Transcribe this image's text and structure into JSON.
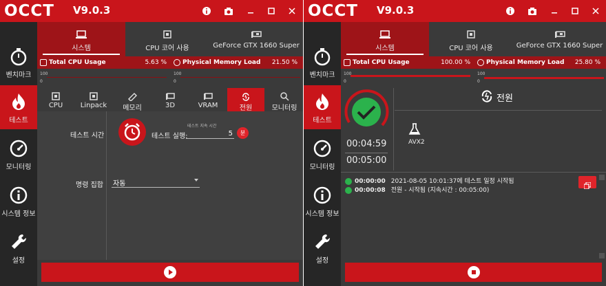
{
  "app": {
    "logo_text": "OCCT",
    "version": "V9.0.3",
    "title_icons": [
      "info-icon",
      "camera-icon",
      "minimize-icon",
      "maximize-icon",
      "close-icon"
    ]
  },
  "colors": {
    "accent": "#c9151b",
    "accent_dark": "#9e1418",
    "sidebar_bg": "#262626",
    "content_bg": "#3a3a3a",
    "success": "#2bb24c"
  },
  "sidebar": {
    "items": [
      {
        "label": "벤치마크",
        "icon": "stopwatch-icon"
      },
      {
        "label": "테스트",
        "icon": "flame-icon"
      },
      {
        "label": "모니터링",
        "icon": "gauge-icon"
      },
      {
        "label": "시스템 정보",
        "icon": "info-circle-icon"
      },
      {
        "label": "설정",
        "icon": "wrench-icon"
      }
    ]
  },
  "device_tabs": [
    {
      "label": "시스템",
      "icon": "laptop-icon"
    },
    {
      "label": "CPU 코어 사용",
      "icon": "cpu-icon"
    },
    {
      "label": "GeForce GTX 1660 Super",
      "icon": "gpu-icon"
    }
  ],
  "left": {
    "usage": {
      "cpu_label": "Total CPU Usage",
      "cpu_value": "5.63 %",
      "mem_label": "Physical Memory Load",
      "mem_value": "21.50 %"
    },
    "mini_scale": {
      "max": "100",
      "min": "0"
    },
    "test_tabs": [
      {
        "label": "CPU",
        "icon": "cpu-icon"
      },
      {
        "label": "Linpack",
        "icon": "cpu-icon"
      },
      {
        "label": "메모리",
        "icon": "memory-icon"
      },
      {
        "label": "3D",
        "icon": "gpu-icon"
      },
      {
        "label": "VRAM",
        "icon": "gpu-icon"
      },
      {
        "label": "전원",
        "icon": "power-cycle-icon"
      },
      {
        "label": "모니터링",
        "icon": "magnifier-icon"
      }
    ],
    "settings": {
      "test_time_label": "테스트 시간",
      "duration_caption": "테스트 지속 시간",
      "run_label": "테스트 실행:",
      "run_value": "5",
      "unit_badge": "분",
      "instruction_set_label": "명령 집합",
      "instruction_set_value": "자동"
    }
  },
  "right": {
    "usage": {
      "cpu_label": "Total CPU Usage",
      "cpu_value": "100.00 %",
      "mem_label": "Physical Memory Load",
      "mem_value": "25.80 %"
    },
    "mini_scale": {
      "max": "100",
      "min": "0"
    },
    "elapsed": "00:04:59",
    "total": "00:05:00",
    "test_name": "전원",
    "instruction": "AVX2",
    "log": [
      {
        "time": "00:00:00",
        "text": "2021-08-05 10:01:37에 테스트 일정 시작됨"
      },
      {
        "time": "00:00:08",
        "text": "전원 - 시작됨 (지속시간 : 00:05:00)"
      }
    ]
  }
}
